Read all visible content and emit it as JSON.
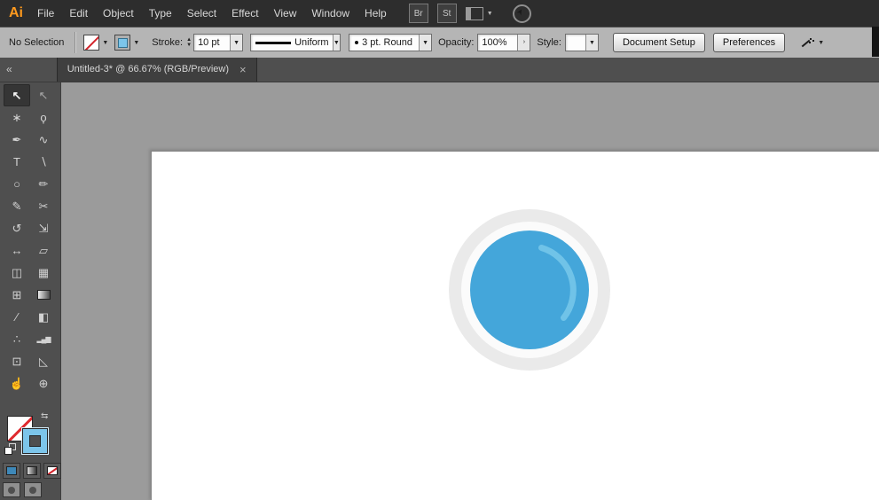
{
  "icons": {
    "caret_down": "▼",
    "caret_up": "▲",
    "chevron_right": "›",
    "collapse_left": "«",
    "swap_arrows": "⇆"
  },
  "menubar": {
    "logo": "Ai",
    "items": [
      "File",
      "Edit",
      "Object",
      "Type",
      "Select",
      "Effect",
      "View",
      "Window",
      "Help"
    ],
    "bridge_button": "Br",
    "stock_button": "St"
  },
  "controlbar": {
    "selection_status": "No Selection",
    "stroke_label": "Stroke:",
    "stroke_weight": "10 pt",
    "width_profile": "Uniform",
    "brush_name": "3 pt. Round",
    "opacity_label": "Opacity:",
    "opacity_value": "100%",
    "style_label": "Style:",
    "document_setup_button": "Document Setup",
    "preferences_button": "Preferences"
  },
  "tabbar": {
    "document_title": "Untitled-3* @ 66.67% (RGB/Preview)",
    "close_icon": "×"
  },
  "toolbar": {
    "tools": [
      {
        "name": "selection-tool",
        "glyph": "↖",
        "selected": true
      },
      {
        "name": "direct-selection-tool",
        "glyph": "↖"
      },
      {
        "name": "magic-wand-tool",
        "glyph": "∗"
      },
      {
        "name": "lasso-tool",
        "glyph": "ϙ"
      },
      {
        "name": "pen-tool",
        "glyph": "✒"
      },
      {
        "name": "curvature-tool",
        "glyph": "∿"
      },
      {
        "name": "type-tool",
        "glyph": "T"
      },
      {
        "name": "line-segment-tool",
        "glyph": "∖"
      },
      {
        "name": "ellipse-tool",
        "glyph": "○"
      },
      {
        "name": "paintbrush-tool",
        "glyph": "✏"
      },
      {
        "name": "pencil-tool",
        "glyph": "✎"
      },
      {
        "name": "scissors-tool",
        "glyph": "✂"
      },
      {
        "name": "rotate-tool",
        "glyph": "↺"
      },
      {
        "name": "scale-tool",
        "glyph": "⇲"
      },
      {
        "name": "width-tool",
        "glyph": "↔"
      },
      {
        "name": "free-transform-tool",
        "glyph": "▱"
      },
      {
        "name": "shape-builder-tool",
        "glyph": "◫"
      },
      {
        "name": "perspective-grid-tool",
        "glyph": "▦"
      },
      {
        "name": "mesh-tool",
        "glyph": "⊞"
      },
      {
        "name": "gradient-tool",
        "type": "gradient"
      },
      {
        "name": "eyedropper-tool",
        "glyph": "∕"
      },
      {
        "name": "blend-tool",
        "glyph": "◧"
      },
      {
        "name": "symbol-sprayer-tool",
        "glyph": "∴"
      },
      {
        "name": "column-graph-tool",
        "glyph": "▂▄▆",
        "small": true
      },
      {
        "name": "artboard-tool",
        "glyph": "⊡"
      },
      {
        "name": "slice-tool",
        "glyph": "◺"
      },
      {
        "name": "hand-tool",
        "glyph": "☝"
      },
      {
        "name": "zoom-tool",
        "glyph": "⊕"
      }
    ]
  },
  "swatches": {
    "fill": "None",
    "stroke_color": "#7CC5EA"
  },
  "artwork": {
    "description": "blue circle button icon",
    "outer_ring_color": "#EAEAEA",
    "inner_ring_color": "#FBFBFB",
    "fill_color": "#44A6DA",
    "highlight_color": "#70C3E8"
  }
}
